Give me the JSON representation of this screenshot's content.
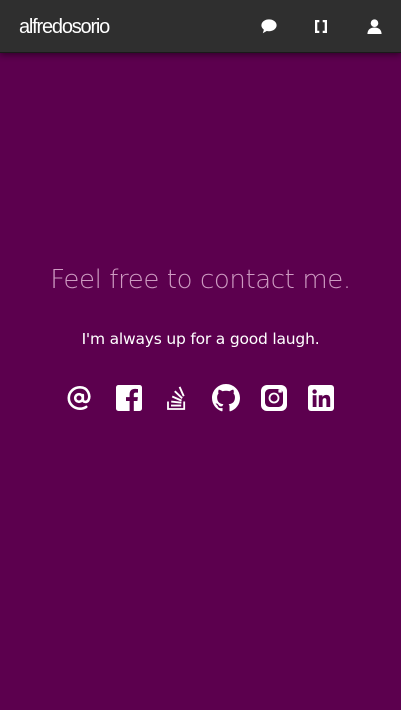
{
  "navbar": {
    "brand": "alfredosorio",
    "icons": [
      "chat-icon",
      "brackets-icon",
      "user-icon"
    ]
  },
  "main": {
    "heading": "Feel free to contact me.",
    "subheading": "I'm always up for a good laugh.",
    "social_icons": [
      "email-at-icon",
      "facebook-icon",
      "stack-overflow-icon",
      "github-icon",
      "instagram-icon",
      "linkedin-icon"
    ]
  },
  "colors": {
    "navbar_bg": "#2f2f2f",
    "page_bg": "#5c004e",
    "heading": "#e7bedc",
    "text": "#ffffff"
  }
}
